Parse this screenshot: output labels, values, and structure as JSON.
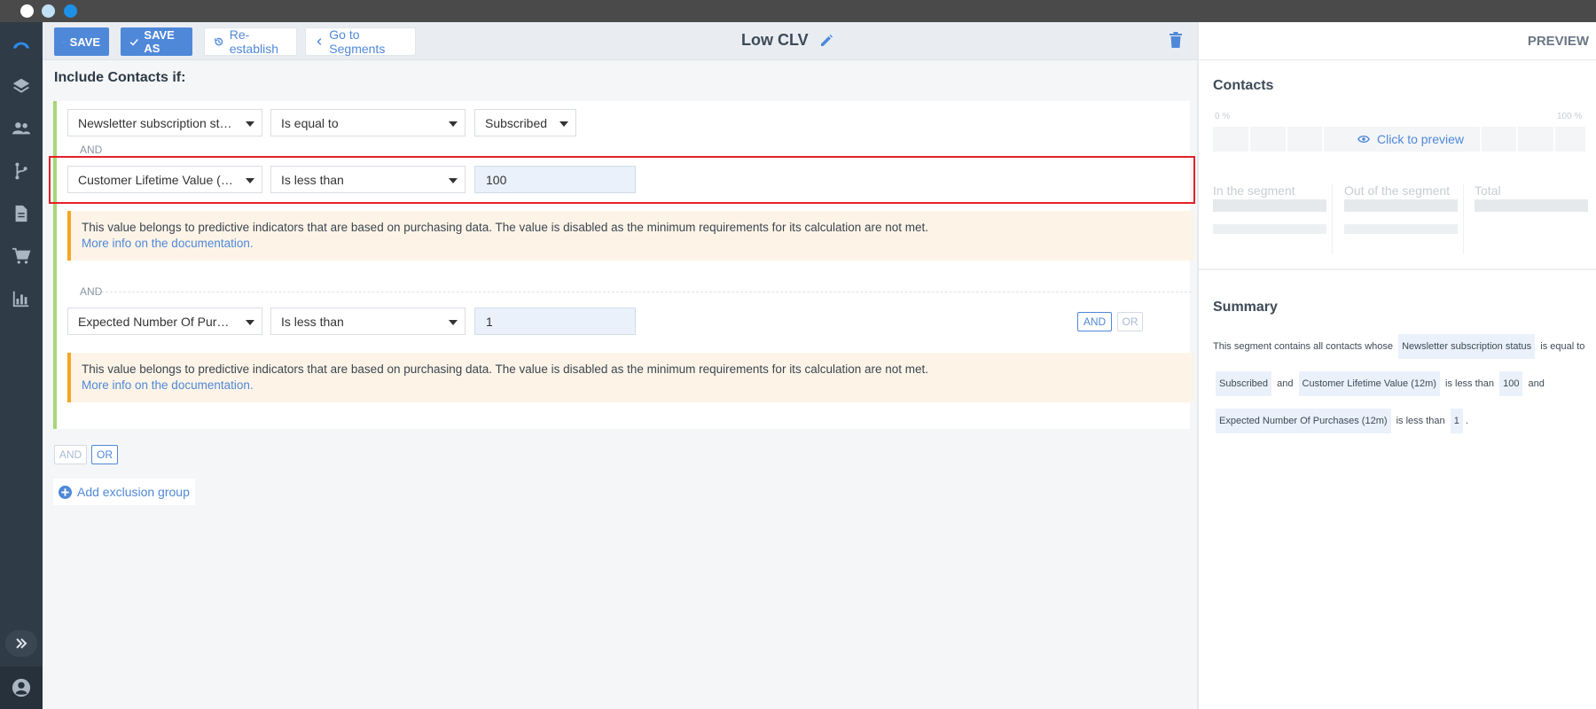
{
  "toolbar": {
    "save_label": "SAVE",
    "save_as_label": "SAVE AS",
    "reestablish_label": "Re-establish",
    "goto_segments_label": "Go to Segments",
    "title": "Low CLV"
  },
  "main": {
    "include_title": "Include Contacts if:",
    "conditions": [
      {
        "field": "Newsletter subscription status",
        "operator": "Is equal to",
        "value": "Subscribed"
      },
      {
        "field": "Customer Lifetime Value (12m)",
        "operator": "Is less than",
        "value": "100"
      },
      {
        "field": "Expected Number Of Purchases (12m)",
        "operator": "Is less than",
        "value": "1"
      }
    ],
    "and_label": "AND",
    "notice_text": "This value belongs to predictive indicators that are based on purchasing data. The value is disabled as the minimum requirements for its calculation are not met.",
    "notice_link": "More info on the documentation.",
    "row_and": "AND",
    "row_or": "OR",
    "group_and": "AND",
    "group_or": "OR",
    "add_exclusion": "Add exclusion group"
  },
  "preview": {
    "label": "PREVIEW",
    "contacts_title": "Contacts",
    "pct_min": "0 %",
    "pct_max": "100 %",
    "click_to_preview": "Click to preview",
    "in_segment": "In the segment",
    "out_segment": "Out of the segment",
    "total": "Total",
    "summary_title": "Summary",
    "summary": {
      "intro": "This segment contains all contacts whose",
      "c1_field": "Newsletter subscription status",
      "c1_op": "is equal to",
      "c1_value": "Subscribed",
      "and1": "and",
      "c2_field": "Customer Lifetime Value (12m)",
      "c2_op": "is less than",
      "c2_value": "100",
      "and2": "and",
      "c3_field": "Expected Number Of Purchases (12m)",
      "c3_op": "is less than",
      "c3_value": "1",
      "end": "."
    }
  },
  "colors": {
    "accent": "#4f88d9",
    "group_border": "#a6d67a",
    "notice_border": "#f5a623",
    "highlight": "#e3202a"
  }
}
